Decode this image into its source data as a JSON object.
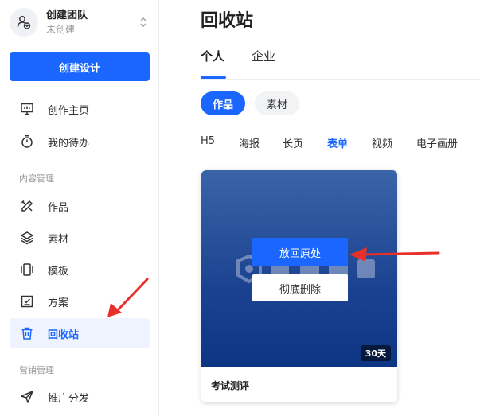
{
  "team": {
    "name": "创建团队",
    "status": "未创建"
  },
  "sidebar": {
    "create_label": "创建设计",
    "top_items": [
      {
        "label": "创作主页",
        "icon": "monitor-icon"
      },
      {
        "label": "我的待办",
        "icon": "timer-icon"
      }
    ],
    "content_section": "内容管理",
    "content_items": [
      {
        "label": "作品",
        "icon": "pencil-ruler-icon"
      },
      {
        "label": "素材",
        "icon": "layers-icon"
      },
      {
        "label": "模板",
        "icon": "template-icon"
      },
      {
        "label": "方案",
        "icon": "checklist-icon"
      },
      {
        "label": "回收站",
        "icon": "trash-icon",
        "active": true
      }
    ],
    "marketing_section": "营销管理",
    "marketing_items": [
      {
        "label": "推广分发",
        "icon": "send-icon"
      }
    ]
  },
  "main": {
    "title": "回收站",
    "tabs": [
      {
        "label": "个人",
        "active": true
      },
      {
        "label": "企业",
        "active": false
      }
    ],
    "pills": [
      {
        "label": "作品",
        "active": true
      },
      {
        "label": "素材",
        "active": false
      }
    ],
    "filters": [
      {
        "label": "H5",
        "active": false
      },
      {
        "label": "海报",
        "active": false
      },
      {
        "label": "长页",
        "active": false
      },
      {
        "label": "表单",
        "active": true
      },
      {
        "label": "视频",
        "active": false
      },
      {
        "label": "电子画册",
        "active": false
      }
    ],
    "card": {
      "restore_label": "放回原处",
      "delete_label": "彻底删除",
      "days_left": "30天",
      "title": "考试测评"
    }
  },
  "colors": {
    "accent": "#1a66ff",
    "active_bg": "#eef3ff",
    "arrow": "#e8302a"
  }
}
